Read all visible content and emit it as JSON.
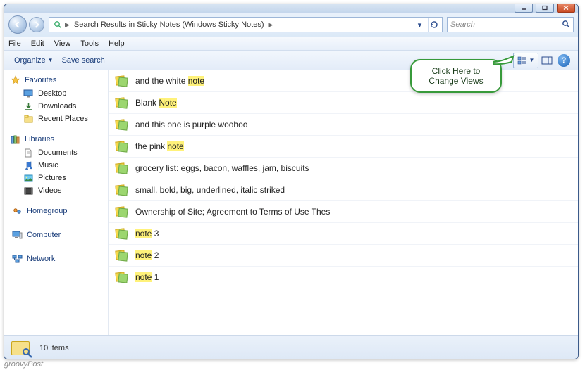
{
  "window_controls": {
    "min": "Minimize",
    "max": "Maximize",
    "close": "Close"
  },
  "breadcrumb": {
    "path": "Search Results in Sticky Notes (Windows Sticky Notes)",
    "segments": [
      "Search Results in Sticky Notes (Windows Sticky Notes)"
    ]
  },
  "search": {
    "placeholder": "Search"
  },
  "menu": {
    "file": "File",
    "edit": "Edit",
    "view": "View",
    "tools": "Tools",
    "help": "Help"
  },
  "toolbar": {
    "organize": "Organize",
    "save_search": "Save search"
  },
  "sidebar": {
    "favorites": {
      "label": "Favorites",
      "items": [
        "Desktop",
        "Downloads",
        "Recent Places"
      ]
    },
    "libraries": {
      "label": "Libraries",
      "items": [
        "Documents",
        "Music",
        "Pictures",
        "Videos"
      ]
    },
    "homegroup": "Homegroup",
    "computer": "Computer",
    "network": "Network"
  },
  "results": [
    {
      "segments": [
        {
          "t": "and the white "
        },
        {
          "t": "note",
          "hl": true
        }
      ]
    },
    {
      "segments": [
        {
          "t": "Blank "
        },
        {
          "t": "Note",
          "hl": true
        }
      ]
    },
    {
      "segments": [
        {
          "t": "and this one is purple woohoo"
        }
      ]
    },
    {
      "segments": [
        {
          "t": "the pink "
        },
        {
          "t": "note",
          "hl": true
        }
      ]
    },
    {
      "segments": [
        {
          "t": "grocery list: eggs, bacon, waffles, jam, biscuits"
        }
      ]
    },
    {
      "segments": [
        {
          "t": "small, bold,  big,  underlined, italic striked"
        }
      ]
    },
    {
      "segments": [
        {
          "t": "Ownership of Site; Agreement to Terms of Use Thes"
        }
      ]
    },
    {
      "segments": [
        {
          "t": "note",
          "hl": true
        },
        {
          "t": " 3"
        }
      ]
    },
    {
      "segments": [
        {
          "t": "note",
          "hl": true
        },
        {
          "t": " 2"
        }
      ]
    },
    {
      "segments": [
        {
          "t": "note",
          "hl": true
        },
        {
          "t": " 1"
        }
      ]
    }
  ],
  "status": {
    "count_label": "10 items"
  },
  "callout": {
    "line1": "Click Here to",
    "line2": "Change Views"
  },
  "watermark": "groovyPost"
}
